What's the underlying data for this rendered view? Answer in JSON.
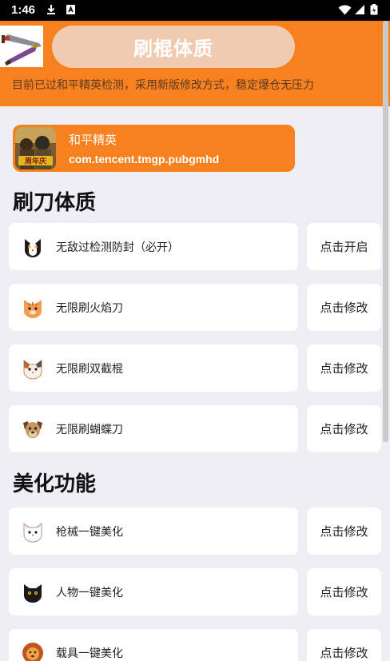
{
  "status_bar": {
    "time": "1:46"
  },
  "header": {
    "title": "刷棍体质",
    "subtitle": "目前已过和平精英检测，采用新版修改方式，稳定爆仓无压力"
  },
  "app": {
    "name": "和平精英",
    "package": "com.tencent.tmgp.pubgmhd",
    "icon_text": "周年庆"
  },
  "sections": [
    {
      "title": "刷刀体质",
      "items": [
        {
          "icon": "cat-bw-icon",
          "label": "无敌过检测防封（必开）",
          "button": "点击开启"
        },
        {
          "icon": "orange-cat-icon",
          "label": "无限刷火焰刀",
          "button": "点击修改"
        },
        {
          "icon": "calico-cat-icon",
          "label": "无限刷双截棍",
          "button": "点击修改"
        },
        {
          "icon": "dog-icon",
          "label": "无限刷蝴蝶刀",
          "button": "点击修改"
        }
      ]
    },
    {
      "title": "美化功能",
      "items": [
        {
          "icon": "white-cat-icon",
          "label": "枪械一键美化",
          "button": "点击修改"
        },
        {
          "icon": "black-cat-icon",
          "label": "人物一键美化",
          "button": "点击修改"
        },
        {
          "icon": "lion-icon",
          "label": "载具一键美化",
          "button": "点击修改"
        }
      ]
    }
  ],
  "colors": {
    "accent": "#f8811f",
    "pill": "#f1cbb0",
    "background": "#efeef4"
  }
}
